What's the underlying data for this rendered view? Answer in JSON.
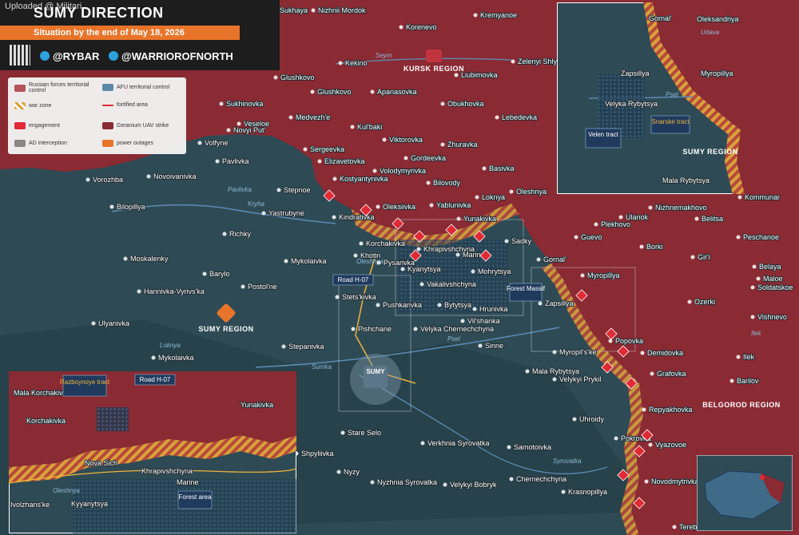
{
  "header": {
    "upload_note": "Uploaded @ Militari",
    "title": "SUMY DIRECTION",
    "subtitle": "Situation by the end of May 18, 2026",
    "social_1": "@RYBAR",
    "social_2": "@WARRIOROFNORTH"
  },
  "legend": {
    "russian": "Russian forces territorial control",
    "afu": "AFU territorial control",
    "war_zone": "war zone",
    "fortified": "fortified area",
    "engagement": "engagement",
    "geranium": "Geranium UAV strike",
    "ad": "AD interception",
    "power": "power outages"
  },
  "colors": {
    "russian": "#8a2a33",
    "afu": "#2c4a56",
    "war_zone": "#d9a23a",
    "accent": "#e8742a",
    "engagement": "#e02a35",
    "afu_arrow": "#3a8cd0"
  },
  "regions": {
    "kursk": "KURSK REGION",
    "sumy": "SUMY REGION",
    "belgorod": "BELGOROD REGION",
    "sumy_inset": "SUMY REGION"
  },
  "rivers": {
    "seym": "Seym",
    "pavlivka": "Pavlivka",
    "krynka": "Kryha",
    "oleshnya": "Oleshnya",
    "psel": "Psel",
    "loknya": "Loknya",
    "sumka": "Sumka",
    "syrovatka": "Syrovatka",
    "ilek": "Ilek",
    "udava": "Udava",
    "psel_inset": "Psel",
    "oleshnya_inset": "Oleshnya"
  },
  "callouts": {
    "road_h07": "Road H-07",
    "forest_massif": "Forest Massif",
    "inset_ne_velen": "Velen tract",
    "inset_ne_snarske": "Snarske tract",
    "inset_sw_razboynoye": "Razbоynoye tract",
    "inset_sw_road": "Road H-07",
    "inset_sw_forest": "Forest area",
    "sumy_city": "SUMY"
  },
  "main_places": [
    "Sukhaya",
    "Nizhnii Mordok",
    "Korenevo",
    "Kremyanoe",
    "Kekino",
    "Glushkovo",
    "Liubimovka",
    "Zelenyi Shlyakh",
    "Sukhinovka",
    "Veseloe",
    "Glushkovo",
    "Apanasovka",
    "Obukhovka",
    "Medvezh'e",
    "Kul'baki",
    "Lebedevka",
    "Novyi Put'",
    "Sergeevka",
    "Viktorovka",
    "Zhuravka",
    "Volfyne",
    "Elizavetovka",
    "Gordeevka",
    "Basivka",
    "Pavlivka",
    "Volodymyrivka",
    "Bilovody",
    "Vorozhba",
    "Novoivanivka",
    "Stepnoe",
    "Kostyantynivka",
    "Loknya",
    "Oleshnya",
    "Bilopillya",
    "Yastrubyne",
    "Oleksiivka",
    "Yablunivka",
    "Kindrativka",
    "Yunakivka",
    "Richky",
    "Korchakivka",
    "Khrapivshchyna",
    "Sadky",
    "Moskalenky",
    "Mykolaivka",
    "Khotin",
    "Pysarivka",
    "Kyanytsya",
    "Marine",
    "Barylo",
    "Vakalivshchyna",
    "Mohrytsya",
    "Hannivka-Vyrivs'ka",
    "Postol'ne",
    "Stets'kivka",
    "Pushkarivka",
    "Bytytsya",
    "Hrunivka",
    "Ulyanivka",
    "Pishchane",
    "Velyka Chernechchyna",
    "Vil'shanka",
    "Stepanivka",
    "Sinne",
    "Mykolaivka",
    "Stare Selo",
    "Verkhnia Syrovatka",
    "Samotoivka",
    "Shpyliivka",
    "Nyzy",
    "Nyzhnia Syrovatka",
    "Velykyi Bobryk",
    "Chernechchyna",
    "Krasnopillya",
    "Gornal'",
    "Myropillya",
    "Zapsillya",
    "Popovka",
    "Myropil's'ke",
    "Demidovka",
    "Mala Rybytsya",
    "Velykyi Prykil",
    "Grafovka",
    "Repyakhovka",
    "Barilov",
    "Uhroidy",
    "Pokrovka",
    "Vyazovoe",
    "Novodmytrivka",
    "Terebreno",
    "Kommunar",
    "Nizhnemakhovo",
    "Ulanok",
    "Belitsa",
    "Plekhovo",
    "Guevo",
    "Borki",
    "Peschanoe",
    "Gir'i",
    "Belaya",
    "Maloe",
    "Soldatskoe",
    "Ozerki",
    "Vishnevo",
    "Ilek"
  ],
  "inset_ne": {
    "places": [
      "Gornal'",
      "Oleksandriya",
      "Zapsillya",
      "Myropillya",
      "Velyka Rybytsya",
      "Mala Rybytsya"
    ]
  },
  "inset_sw": {
    "places": [
      "Mala Korchakivka",
      "Korchakivka",
      "Nova Sich",
      "Khrapivshchyna",
      "Yunakivka",
      "Marine",
      "Ivolzhans'ke",
      "Kyyanytsya"
    ]
  }
}
